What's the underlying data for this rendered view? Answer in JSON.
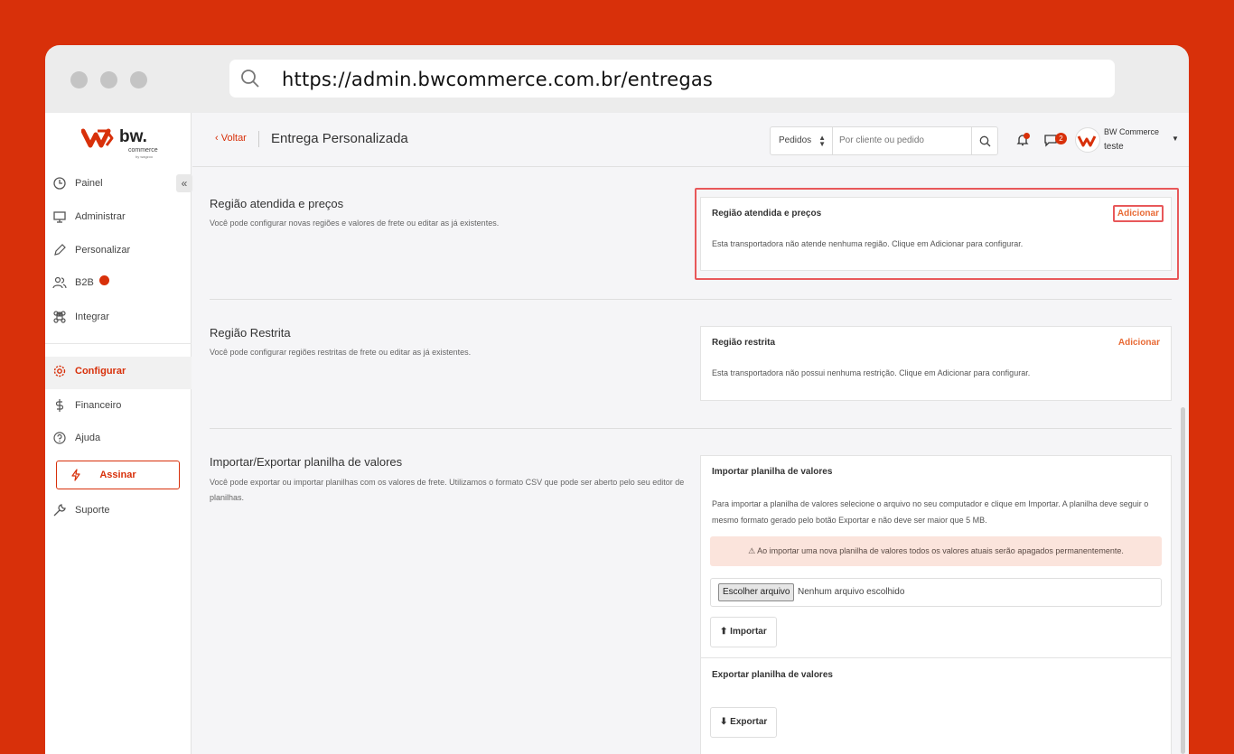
{
  "browser": {
    "url": "https://admin.bwcommerce.com.br/entregas"
  },
  "logo": {
    "brand": "bw.",
    "sub": "commerce",
    "byline": "by wagzoo"
  },
  "sidebar": {
    "items": [
      {
        "label": "Painel",
        "icon": "clock-icon"
      },
      {
        "label": "Administrar",
        "icon": "monitor-icon"
      },
      {
        "label": "Personalizar",
        "icon": "pencil-icon"
      },
      {
        "label": "B2B",
        "icon": "users-icon"
      },
      {
        "label": "Integrar",
        "icon": "command-icon"
      },
      {
        "label": "Configurar",
        "icon": "gear-icon",
        "active": true
      },
      {
        "label": "Financeiro",
        "icon": "dollar-icon"
      },
      {
        "label": "Ajuda",
        "icon": "help-icon"
      },
      {
        "label": "Suporte",
        "icon": "wrench-icon"
      }
    ],
    "assinar_label": "Assinar",
    "collapse_label": "«"
  },
  "header": {
    "back_label": "‹ Voltar",
    "title": "Entrega Personalizada",
    "search_select": "Pedidos",
    "search_placeholder": "Por cliente ou pedido",
    "chat_count": "2",
    "user_name": "BW Commerce",
    "user_sub": "teste"
  },
  "sections": {
    "regiao": {
      "title": "Região atendida e preços",
      "desc": "Você pode configurar novas regiões e valores de frete ou editar as já existentes.",
      "card_title": "Região atendida e preços",
      "card_action": "Adicionar",
      "card_text": "Esta transportadora não atende nenhuma região. Clique em Adicionar para configurar."
    },
    "restrita": {
      "title": "Região Restrita",
      "desc": "Você pode configurar regiões restritas de frete ou editar as já existentes.",
      "card_title": "Região restrita",
      "card_action": "Adicionar",
      "card_text": "Esta transportadora não possui nenhuma restrição. Clique em Adicionar para configurar."
    },
    "planilha": {
      "title": "Importar/Exportar planilha de valores",
      "desc": "Você pode exportar ou importar planilhas com os valores de frete. Utilizamos o formato CSV que pode ser aberto pelo seu editor de planilhas.",
      "import_title": "Importar planilha de valores",
      "import_text": "Para importar a planilha de valores selecione o arquivo no seu computador e clique em Importar. A planilha deve seguir o mesmo formato gerado pelo botão Exportar e não deve ser maior que 5 MB.",
      "warning": "Ao importar uma nova planilha de valores todos os valores atuais serão apagados permanentemente.",
      "file_button": "Escolher arquivo",
      "file_label": "Nenhum arquivo escolhido",
      "import_button": "Importar",
      "export_title": "Exportar planilha de valores",
      "export_button": "Exportar"
    }
  },
  "colors": {
    "brand": "#d8300a",
    "accent": "#e86a35",
    "highlight": "#e8585a"
  }
}
